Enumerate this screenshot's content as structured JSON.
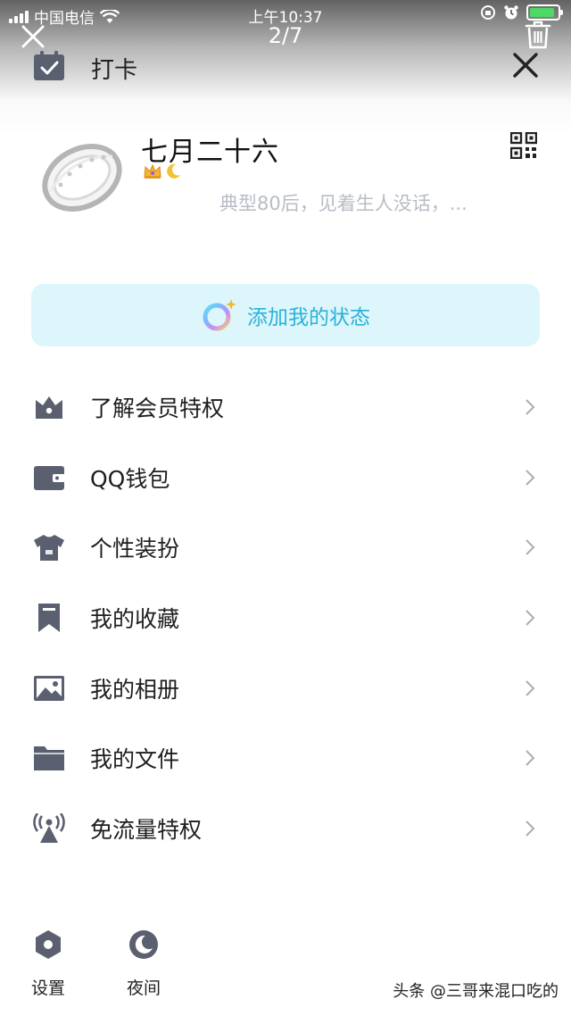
{
  "status_bar": {
    "carrier": "中国电信",
    "time": "上午10:37",
    "battery_level": 0.9
  },
  "viewer": {
    "counter": "2/7",
    "close_icon": "close-icon",
    "trash_icon": "trash-icon"
  },
  "header": {
    "checkin_label": "打卡",
    "close_icon": "close-icon"
  },
  "profile": {
    "nickname": "七月二十六",
    "badges": [
      "crown-badge-icon",
      "moon-badge-icon"
    ],
    "signature": "典型80后，见着生人没话，...",
    "qr_icon": "qr-code-icon"
  },
  "status_button": {
    "label": "添加我的状态"
  },
  "menu": {
    "items": [
      {
        "label": "了解会员特权",
        "icon": "crown-icon"
      },
      {
        "label": "QQ钱包",
        "icon": "wallet-icon"
      },
      {
        "label": "个性装扮",
        "icon": "shirt-icon"
      },
      {
        "label": "我的收藏",
        "icon": "bookmark-icon"
      },
      {
        "label": "我的相册",
        "icon": "photo-icon"
      },
      {
        "label": "我的文件",
        "icon": "folder-icon"
      },
      {
        "label": "免流量特权",
        "icon": "antenna-icon"
      }
    ]
  },
  "bottom": {
    "settings_label": "设置",
    "night_label": "夜间"
  },
  "watermark": "头条 @三哥来混口吃的",
  "colors": {
    "icon_gray": "#5a6070",
    "status_bg": "#dcf6fb",
    "status_text": "#2bb2d8",
    "signature_text": "#b8bcc6"
  }
}
